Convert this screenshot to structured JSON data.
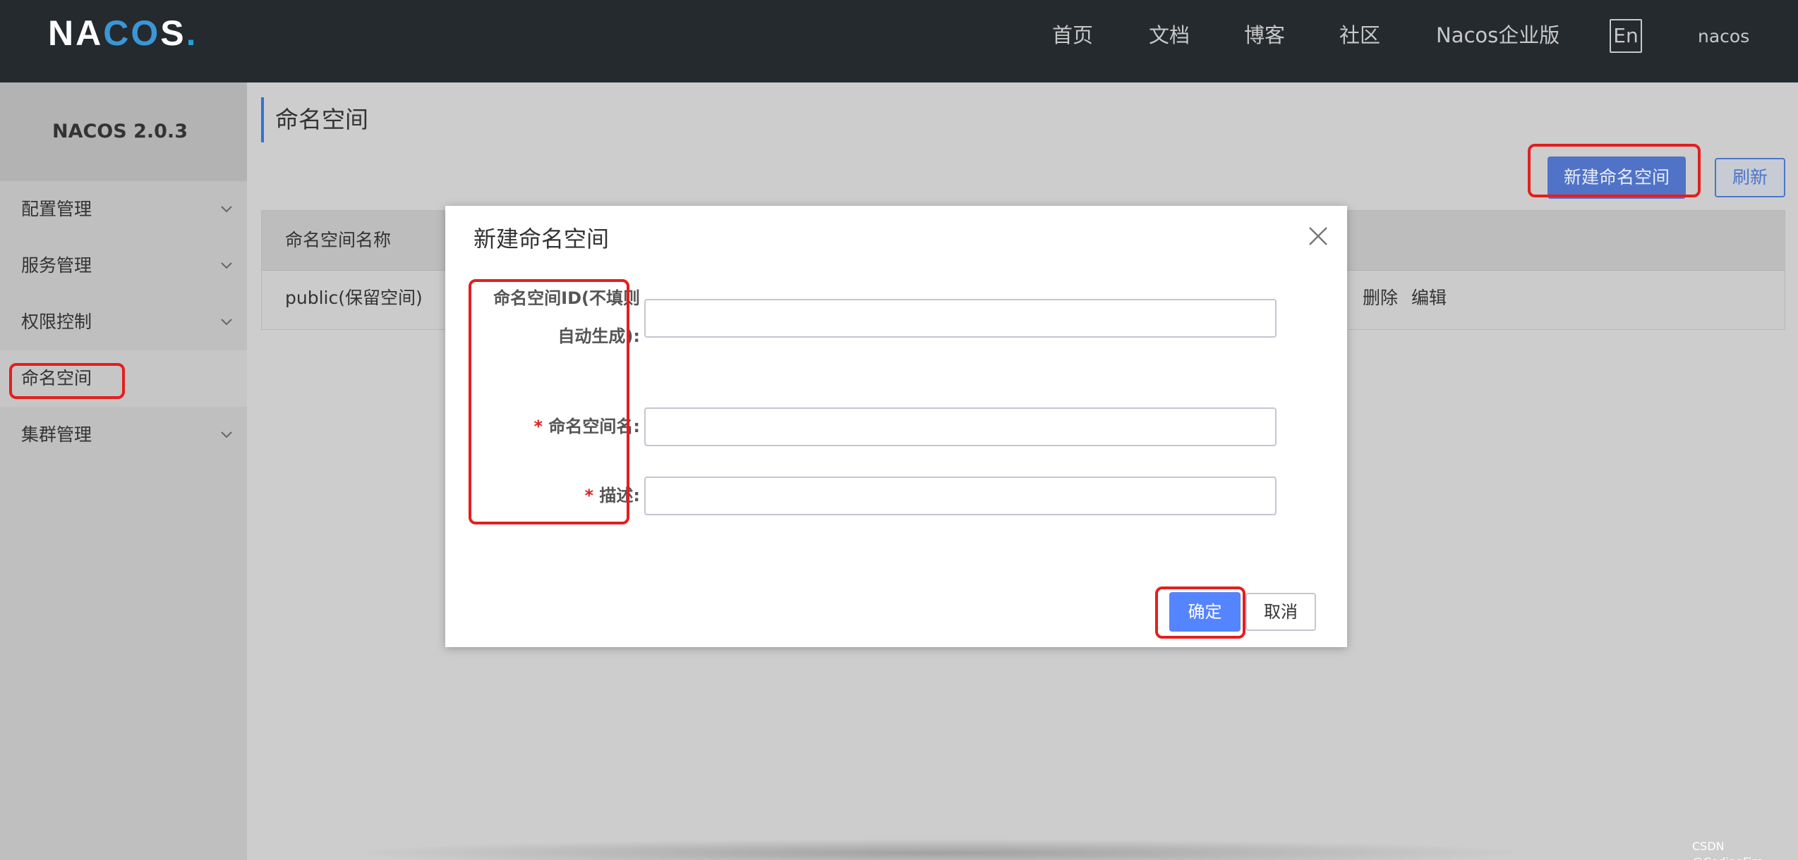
{
  "header": {
    "logo_text": "NACOS.",
    "nav": [
      "首页",
      "文档",
      "博客",
      "社区",
      "Nacos企业版"
    ],
    "lang_button": "En",
    "username": "nacos"
  },
  "sidebar": {
    "version": "NACOS 2.0.3",
    "items": [
      {
        "label": "配置管理",
        "has_children": true
      },
      {
        "label": "服务管理",
        "has_children": true
      },
      {
        "label": "权限控制",
        "has_children": true
      },
      {
        "label": "命名空间",
        "has_children": false,
        "active": true
      },
      {
        "label": "集群管理",
        "has_children": true
      }
    ]
  },
  "main": {
    "title": "命名空间",
    "new_button": "新建命名空间",
    "refresh_button": "刷新",
    "table": {
      "header": "命名空间名称",
      "rows": [
        {
          "name": "public(保留空间)",
          "actions": [
            "删除",
            "编辑"
          ]
        }
      ]
    }
  },
  "modal": {
    "title": "新建命名空间",
    "fields": [
      {
        "label_line1": "命名空间ID(不填则",
        "label_line2": "自动生成):",
        "required": false,
        "value": "",
        "placeholder": ""
      },
      {
        "label": "命名空间名:",
        "required": true,
        "value": "",
        "placeholder": ""
      },
      {
        "label": "描述:",
        "required": true,
        "value": "",
        "placeholder": ""
      }
    ],
    "ok_button": "确定",
    "cancel_button": "取消"
  },
  "watermark": "CSDN @CodingFire",
  "colors": {
    "topbar": "#252a2f",
    "primary": "#5584ff",
    "annotation": "#e41e1e"
  }
}
